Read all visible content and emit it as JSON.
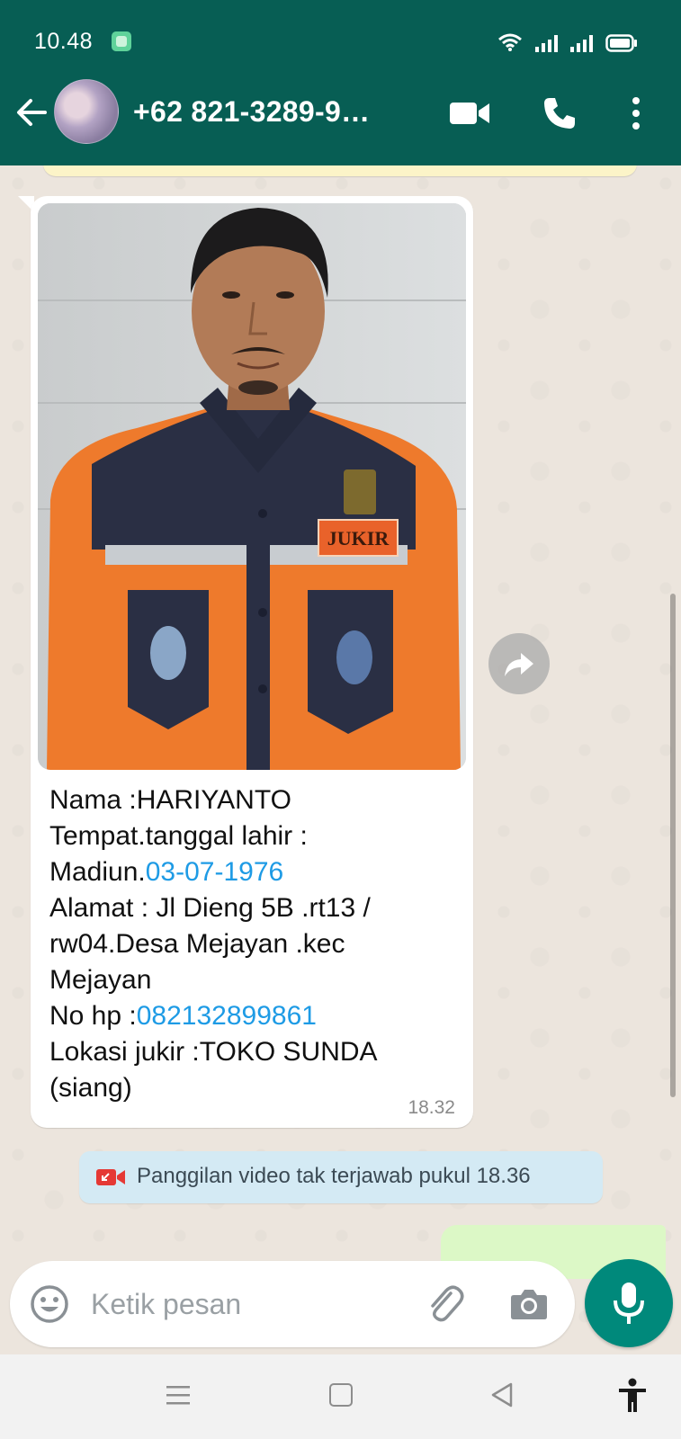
{
  "status_bar": {
    "time": "10.48",
    "icons": [
      "notification-app-icon",
      "wifi-icon",
      "signal-icon",
      "signal-icon",
      "battery-icon"
    ]
  },
  "header": {
    "contact_name": "+62 821-3289-9…",
    "icons": [
      "back-arrow-icon",
      "video-call-icon",
      "phone-call-icon",
      "more-options-icon"
    ]
  },
  "message": {
    "lines": [
      {
        "parts": [
          {
            "text": "Nama :HARIYANTO",
            "link": false
          }
        ]
      },
      {
        "parts": [
          {
            "text": "Tempat.tanggal lahir :",
            "link": false
          }
        ]
      },
      {
        "parts": [
          {
            "text": "Madiun.",
            "link": false
          },
          {
            "text": "03-07-1976",
            "link": true
          }
        ]
      },
      {
        "parts": [
          {
            "text": "Alamat : Jl Dieng 5B .rt13 /",
            "link": false
          }
        ]
      },
      {
        "parts": [
          {
            "text": "rw04.Desa Mejayan .kec",
            "link": false
          }
        ]
      },
      {
        "parts": [
          {
            "text": "Mejayan",
            "link": false
          }
        ]
      },
      {
        "parts": [
          {
            "text": "No hp :",
            "link": false
          },
          {
            "text": "082132899861",
            "link": true
          }
        ]
      },
      {
        "parts": [
          {
            "text": "Lokasi jukir :TOKO SUNDA",
            "link": false
          }
        ]
      },
      {
        "parts": [
          {
            "text": "(siang)",
            "link": false
          }
        ]
      }
    ],
    "time": "18.32",
    "photo_badge_text": "JUKIR"
  },
  "system_message": {
    "text": "Panggilan video tak terjawab pukul 18.36",
    "icon": "missed-video-call-icon"
  },
  "composer": {
    "placeholder": "Ketik pesan",
    "icons": [
      "emoji-icon",
      "attach-icon",
      "camera-icon",
      "mic-icon"
    ]
  },
  "colors": {
    "header": "#075e54",
    "incoming_bubble": "#ffffff",
    "outgoing_bubble": "#dcf8c6",
    "link": "#1e9be5",
    "mic_button": "#00897b",
    "system_pill": "#d4eaf4"
  }
}
